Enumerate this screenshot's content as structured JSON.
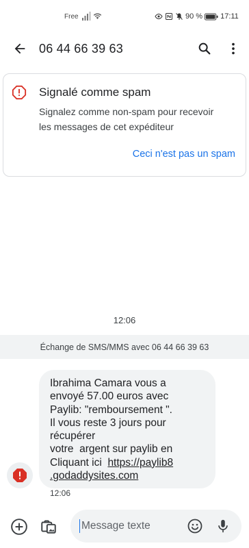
{
  "status_bar": {
    "carrier": "Free",
    "battery": "90 %",
    "time": "17:11",
    "icons": [
      "signal-icon",
      "wifi-icon",
      "eye-icon",
      "nfc-icon",
      "mute-icon",
      "battery-icon"
    ]
  },
  "app_bar": {
    "title": "06 44 66 39 63",
    "icons": [
      "back-arrow-icon",
      "search-icon",
      "more-vert-icon"
    ]
  },
  "spam_card": {
    "title": "Signalé comme spam",
    "description_lines": [
      "Signalez comme non-spam pour recevoir",
      "les messages de cet expéditeur"
    ],
    "action_label": "Ceci n'est pas un spam",
    "accent_color": "#d93025",
    "link_color": "#1a73e8"
  },
  "conversation": {
    "time_label": "12:06",
    "exchange_banner": "Échange de SMS/MMS avec 06 44 66 39 63",
    "message": {
      "lines": [
        "Ibrahima Camara vous a",
        "envoyé 57.00 euros avec",
        "Paylib: \"remboursement \".",
        "Il vous reste 3 jours pour",
        "récupérer",
        "votre  argent sur paylib en",
        "Cliquant ici  "
      ],
      "link_part1": "https://paylib8",
      "link_part2": ".godaddysites.com",
      "timestamp": "12:06"
    }
  },
  "compose": {
    "placeholder": "Message texte",
    "icons": [
      "add-icon",
      "gallery-icon",
      "emoji-icon",
      "mic-icon"
    ]
  }
}
